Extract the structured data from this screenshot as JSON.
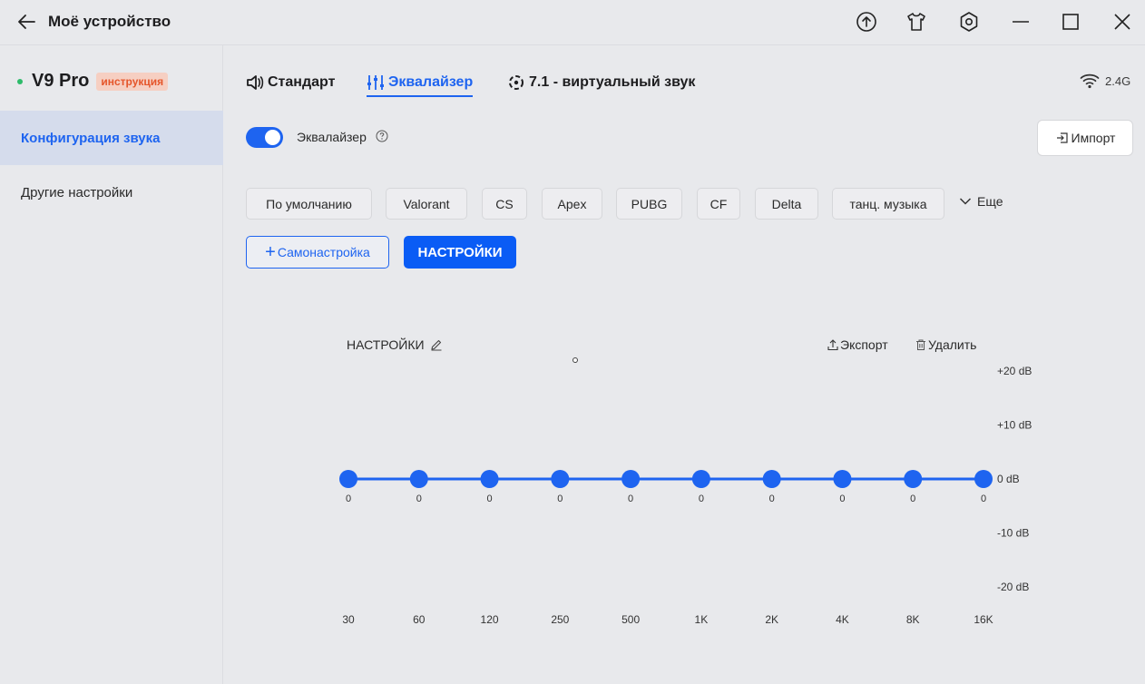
{
  "window": {
    "title": "Моё устройство"
  },
  "device": {
    "name": "V9 Pro",
    "badge": "инструкция"
  },
  "sidebar": {
    "items": [
      {
        "label": "Конфигурация звука",
        "active": true
      },
      {
        "label": "Другие настройки",
        "active": false
      }
    ]
  },
  "tabs": [
    {
      "label": "Стандарт",
      "icon": "speaker-icon"
    },
    {
      "label": "Эквалайзер",
      "icon": "equalizer-icon",
      "active": true
    },
    {
      "label": "7.1 - виртуальный звук",
      "icon": "surround-icon"
    }
  ],
  "connection": {
    "label": "2.4G"
  },
  "equalizer_toggle": {
    "label": "Эквалайзер",
    "enabled": true
  },
  "import_button": {
    "label": "Импорт"
  },
  "presets": [
    "По умолчанию",
    "Valorant",
    "CS",
    "Apex",
    "PUBG",
    "CF",
    "Delta",
    "танц. музыка"
  ],
  "more_label": "Еще",
  "custom_button": {
    "plus": "+",
    "label": "Самонастройка"
  },
  "settings_button": {
    "label": "НАСТРОЙКИ"
  },
  "profile": {
    "name": "НАСТРОЙКИ",
    "export_label": "Экспорт",
    "delete_label": "Удалить"
  },
  "colors": {
    "accent": "#1e64f0",
    "primary_button": "#0a5cf5",
    "status_online": "#2dbb6a",
    "badge_bg": "#f6cfc2",
    "badge_text": "#e5552a"
  },
  "chart_data": {
    "type": "line",
    "x": [
      "30",
      "60",
      "120",
      "250",
      "500",
      "1K",
      "2K",
      "4K",
      "8K",
      "16K"
    ],
    "values": [
      0,
      0,
      0,
      0,
      0,
      0,
      0,
      0,
      0,
      0
    ],
    "ylim": [
      -20,
      20
    ],
    "yticks": [
      {
        "value": 20,
        "label": "+20 dB"
      },
      {
        "value": 10,
        "label": "+10 dB"
      },
      {
        "value": 0,
        "label": "0 dB"
      },
      {
        "value": -10,
        "label": "-10 dB"
      },
      {
        "value": -20,
        "label": "-20 dB"
      }
    ],
    "point_labels": [
      "0",
      "0",
      "0",
      "0",
      "0",
      "0",
      "0",
      "0",
      "0",
      "0"
    ],
    "grid": false
  }
}
